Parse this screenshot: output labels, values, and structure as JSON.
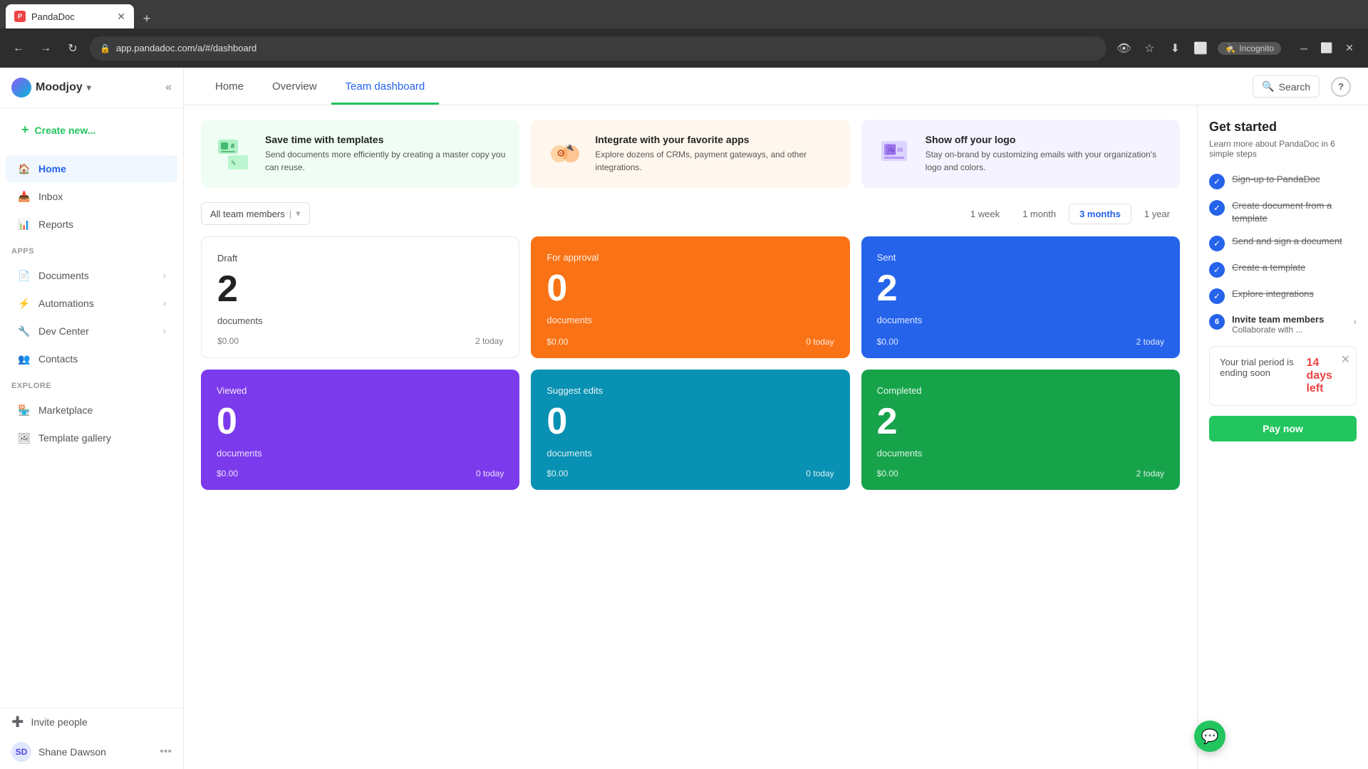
{
  "browser": {
    "tab_title": "PandaDoc",
    "url": "app.pandadoc.com/a/#/dashboard",
    "incognito_label": "Incognito"
  },
  "sidebar": {
    "org_name": "Moodjoy",
    "nav_items": [
      {
        "id": "home",
        "label": "Home",
        "active": true
      },
      {
        "id": "inbox",
        "label": "Inbox"
      },
      {
        "id": "reports",
        "label": "Reports"
      }
    ],
    "apps_section": "APPS",
    "apps": [
      {
        "id": "documents",
        "label": "Documents",
        "expandable": true
      },
      {
        "id": "automations",
        "label": "Automations",
        "expandable": true
      },
      {
        "id": "dev-center",
        "label": "Dev Center",
        "expandable": true
      },
      {
        "id": "contacts",
        "label": "Contacts"
      }
    ],
    "explore_section": "EXPLORE",
    "explore": [
      {
        "id": "marketplace",
        "label": "Marketplace"
      },
      {
        "id": "template-gallery",
        "label": "Template gallery"
      }
    ],
    "footer": [
      {
        "id": "invite-people",
        "label": "Invite people"
      }
    ],
    "user": {
      "name": "Shane Dawson",
      "initials": "SD"
    },
    "create_btn": "Create new..."
  },
  "topnav": {
    "tabs": [
      "Home",
      "Overview",
      "Team dashboard"
    ],
    "active_tab": "Team dashboard",
    "search_label": "Search"
  },
  "promo_cards": [
    {
      "title": "Save time with templates",
      "description": "Send documents more efficiently by creating a master copy you can reuse."
    },
    {
      "title": "Integrate with your favorite apps",
      "description": "Explore dozens of CRMs, payment gateways, and other integrations."
    },
    {
      "title": "Show off your logo",
      "description": "Stay on-brand by customizing emails with your organization's logo and colors."
    }
  ],
  "filter": {
    "team_placeholder": "All team members",
    "time_options": [
      "1 week",
      "1 month",
      "3 months",
      "1 year"
    ],
    "active_time": "3 months"
  },
  "stats": [
    {
      "id": "draft",
      "label": "Draft",
      "number": "2",
      "sub_label": "documents",
      "amount": "$0.00",
      "today": "2 today",
      "color": "white"
    },
    {
      "id": "for-approval",
      "label": "For approval",
      "number": "0",
      "sub_label": "documents",
      "amount": "$0.00",
      "today": "0 today",
      "color": "orange"
    },
    {
      "id": "sent",
      "label": "Sent",
      "number": "2",
      "sub_label": "documents",
      "amount": "$0.00",
      "today": "2 today",
      "color": "blue"
    },
    {
      "id": "viewed",
      "label": "Viewed",
      "number": "0",
      "sub_label": "documents",
      "amount": "$0.00",
      "today": "0 today",
      "color": "purple"
    },
    {
      "id": "suggest-edits",
      "label": "Suggest edits",
      "number": "0",
      "sub_label": "documents",
      "amount": "$0.00",
      "today": "0 today",
      "color": "teal"
    },
    {
      "id": "completed",
      "label": "Completed",
      "number": "2",
      "sub_label": "documents",
      "amount": "$0.00",
      "today": "2 today",
      "color": "green"
    }
  ],
  "right_panel": {
    "title": "Get started",
    "subtitle": "Learn more about PandaDoc in 6 simple steps",
    "checklist": [
      {
        "label": "Sign-up to PandaDoc",
        "done": true
      },
      {
        "label": "Create document from a template",
        "done": true
      },
      {
        "label": "Send and sign a document",
        "done": true
      },
      {
        "label": "Create a template",
        "done": true
      },
      {
        "label": "Explore integrations",
        "done": true
      }
    ],
    "invite": {
      "step": "6",
      "title": "Invite team members",
      "sub": "Collaborate with ..."
    },
    "trial": {
      "text": "Your trial period is ending soon",
      "days_label": "14 days left"
    },
    "pay_btn": "Pay now"
  }
}
